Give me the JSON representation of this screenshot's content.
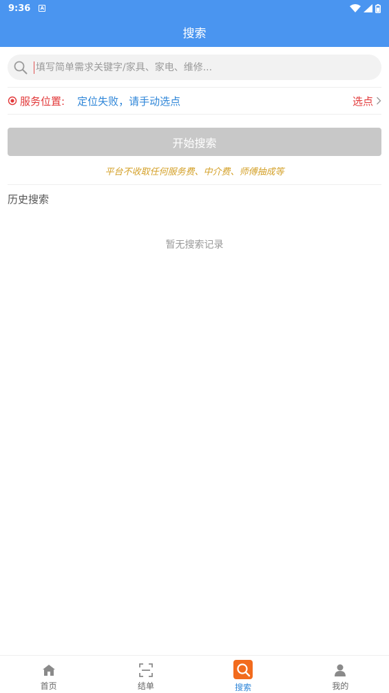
{
  "statusbar": {
    "time": "9:36",
    "notif_glyph": "A"
  },
  "header": {
    "title": "搜索"
  },
  "search": {
    "placeholder": "填写简单需求关键字/家具、家电、维修..."
  },
  "location": {
    "label": "服务位置:",
    "status": "定位失败，请手动选点",
    "pick_label": "选点"
  },
  "search_button": {
    "label": "开始搜索"
  },
  "notice": "平台不收取任何服务费、中介费、师傅抽成等",
  "history": {
    "title": "历史搜索",
    "empty_text": "暂无搜索记录"
  },
  "tabs": [
    {
      "label": "首页",
      "icon": "home-icon"
    },
    {
      "label": "结单",
      "icon": "scan-icon"
    },
    {
      "label": "搜索",
      "icon": "search-icon"
    },
    {
      "label": "我的",
      "icon": "user-icon"
    }
  ],
  "colors": {
    "primary": "#4a95f0",
    "accent_red": "#e2393a",
    "link_blue": "#2f86d8",
    "notice_gold": "#d4a12a",
    "active_tab_bg": "#f26b1d"
  }
}
